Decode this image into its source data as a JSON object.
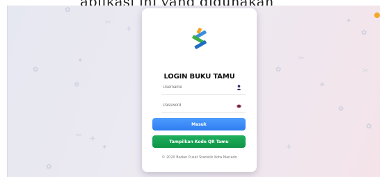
{
  "page_header": {
    "text": "aplikasi ini yang digunakan"
  },
  "login": {
    "title": "LOGIN BUKU TAMU",
    "username_placeholder": "Username",
    "password_placeholder": "Password",
    "submit_label": "Masuk",
    "qr_label": "Tampilkan Kode QR Tamu",
    "footer": "© 2020 Badan Pusat Statistik Kota Manado"
  },
  "icons": {
    "logo": "bps-logo",
    "username": "user-icon",
    "password": "eye-icon"
  },
  "colors": {
    "login_button": "#3a86f5",
    "qr_button": "#16a352",
    "accent_dot": "#f4a72a"
  }
}
